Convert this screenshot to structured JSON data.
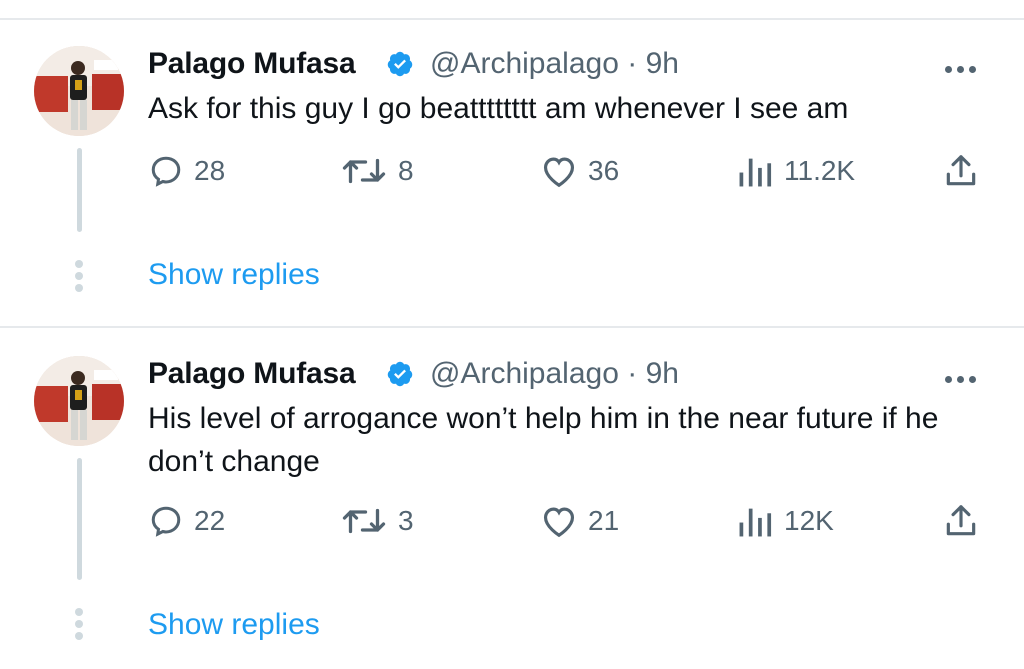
{
  "colors": {
    "accent": "#1d9bf0",
    "text": "#0f1419",
    "muted": "#536471",
    "line": "#cfd9de"
  },
  "tweets": [
    {
      "author_name": "Palago Mufasa",
      "handle": "@Archipalago",
      "time": "· 9h",
      "verified_icon": "verified-badge-icon",
      "text": "Ask for this guy I go beatttttttt am whenever I see am",
      "replies": "28",
      "retweets": "8",
      "likes": "36",
      "views": "11.2K",
      "show_replies": "Show replies"
    },
    {
      "author_name": "Palago Mufasa",
      "handle": "@Archipalago",
      "time": "· 9h",
      "verified_icon": "verified-badge-icon",
      "text": "His level of arrogance won’t help him in the near future if he don’t change",
      "replies": "22",
      "retweets": "3",
      "likes": "21",
      "views": "12K",
      "show_replies": "Show replies"
    }
  ]
}
